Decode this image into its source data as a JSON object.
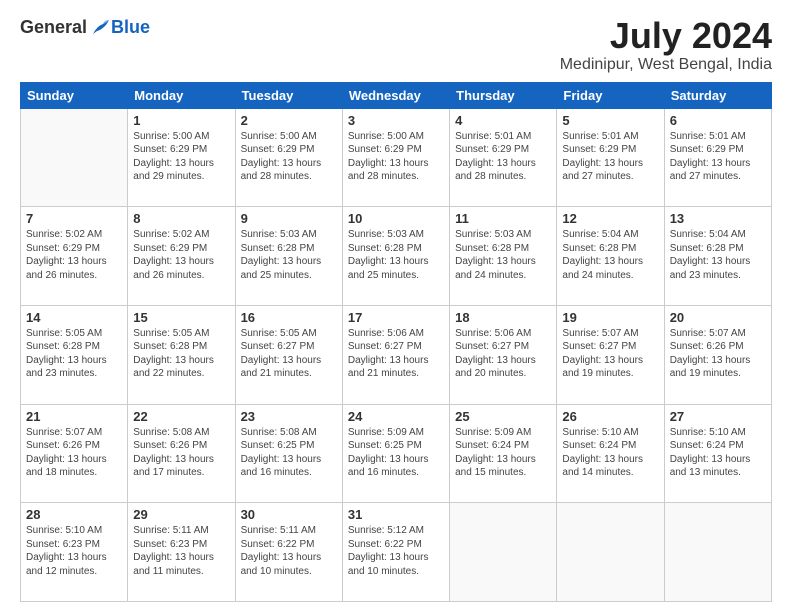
{
  "logo": {
    "general": "General",
    "blue": "Blue"
  },
  "title": "July 2024",
  "location": "Medinipur, West Bengal, India",
  "days_of_week": [
    "Sunday",
    "Monday",
    "Tuesday",
    "Wednesday",
    "Thursday",
    "Friday",
    "Saturday"
  ],
  "weeks": [
    [
      {
        "day": "",
        "info": ""
      },
      {
        "day": "1",
        "info": "Sunrise: 5:00 AM\nSunset: 6:29 PM\nDaylight: 13 hours\nand 29 minutes."
      },
      {
        "day": "2",
        "info": "Sunrise: 5:00 AM\nSunset: 6:29 PM\nDaylight: 13 hours\nand 28 minutes."
      },
      {
        "day": "3",
        "info": "Sunrise: 5:00 AM\nSunset: 6:29 PM\nDaylight: 13 hours\nand 28 minutes."
      },
      {
        "day": "4",
        "info": "Sunrise: 5:01 AM\nSunset: 6:29 PM\nDaylight: 13 hours\nand 28 minutes."
      },
      {
        "day": "5",
        "info": "Sunrise: 5:01 AM\nSunset: 6:29 PM\nDaylight: 13 hours\nand 27 minutes."
      },
      {
        "day": "6",
        "info": "Sunrise: 5:01 AM\nSunset: 6:29 PM\nDaylight: 13 hours\nand 27 minutes."
      }
    ],
    [
      {
        "day": "7",
        "info": "Sunrise: 5:02 AM\nSunset: 6:29 PM\nDaylight: 13 hours\nand 26 minutes."
      },
      {
        "day": "8",
        "info": "Sunrise: 5:02 AM\nSunset: 6:29 PM\nDaylight: 13 hours\nand 26 minutes."
      },
      {
        "day": "9",
        "info": "Sunrise: 5:03 AM\nSunset: 6:28 PM\nDaylight: 13 hours\nand 25 minutes."
      },
      {
        "day": "10",
        "info": "Sunrise: 5:03 AM\nSunset: 6:28 PM\nDaylight: 13 hours\nand 25 minutes."
      },
      {
        "day": "11",
        "info": "Sunrise: 5:03 AM\nSunset: 6:28 PM\nDaylight: 13 hours\nand 24 minutes."
      },
      {
        "day": "12",
        "info": "Sunrise: 5:04 AM\nSunset: 6:28 PM\nDaylight: 13 hours\nand 24 minutes."
      },
      {
        "day": "13",
        "info": "Sunrise: 5:04 AM\nSunset: 6:28 PM\nDaylight: 13 hours\nand 23 minutes."
      }
    ],
    [
      {
        "day": "14",
        "info": "Sunrise: 5:05 AM\nSunset: 6:28 PM\nDaylight: 13 hours\nand 23 minutes."
      },
      {
        "day": "15",
        "info": "Sunrise: 5:05 AM\nSunset: 6:28 PM\nDaylight: 13 hours\nand 22 minutes."
      },
      {
        "day": "16",
        "info": "Sunrise: 5:05 AM\nSunset: 6:27 PM\nDaylight: 13 hours\nand 21 minutes."
      },
      {
        "day": "17",
        "info": "Sunrise: 5:06 AM\nSunset: 6:27 PM\nDaylight: 13 hours\nand 21 minutes."
      },
      {
        "day": "18",
        "info": "Sunrise: 5:06 AM\nSunset: 6:27 PM\nDaylight: 13 hours\nand 20 minutes."
      },
      {
        "day": "19",
        "info": "Sunrise: 5:07 AM\nSunset: 6:27 PM\nDaylight: 13 hours\nand 19 minutes."
      },
      {
        "day": "20",
        "info": "Sunrise: 5:07 AM\nSunset: 6:26 PM\nDaylight: 13 hours\nand 19 minutes."
      }
    ],
    [
      {
        "day": "21",
        "info": "Sunrise: 5:07 AM\nSunset: 6:26 PM\nDaylight: 13 hours\nand 18 minutes."
      },
      {
        "day": "22",
        "info": "Sunrise: 5:08 AM\nSunset: 6:26 PM\nDaylight: 13 hours\nand 17 minutes."
      },
      {
        "day": "23",
        "info": "Sunrise: 5:08 AM\nSunset: 6:25 PM\nDaylight: 13 hours\nand 16 minutes."
      },
      {
        "day": "24",
        "info": "Sunrise: 5:09 AM\nSunset: 6:25 PM\nDaylight: 13 hours\nand 16 minutes."
      },
      {
        "day": "25",
        "info": "Sunrise: 5:09 AM\nSunset: 6:24 PM\nDaylight: 13 hours\nand 15 minutes."
      },
      {
        "day": "26",
        "info": "Sunrise: 5:10 AM\nSunset: 6:24 PM\nDaylight: 13 hours\nand 14 minutes."
      },
      {
        "day": "27",
        "info": "Sunrise: 5:10 AM\nSunset: 6:24 PM\nDaylight: 13 hours\nand 13 minutes."
      }
    ],
    [
      {
        "day": "28",
        "info": "Sunrise: 5:10 AM\nSunset: 6:23 PM\nDaylight: 13 hours\nand 12 minutes."
      },
      {
        "day": "29",
        "info": "Sunrise: 5:11 AM\nSunset: 6:23 PM\nDaylight: 13 hours\nand 11 minutes."
      },
      {
        "day": "30",
        "info": "Sunrise: 5:11 AM\nSunset: 6:22 PM\nDaylight: 13 hours\nand 10 minutes."
      },
      {
        "day": "31",
        "info": "Sunrise: 5:12 AM\nSunset: 6:22 PM\nDaylight: 13 hours\nand 10 minutes."
      },
      {
        "day": "",
        "info": ""
      },
      {
        "day": "",
        "info": ""
      },
      {
        "day": "",
        "info": ""
      }
    ]
  ]
}
